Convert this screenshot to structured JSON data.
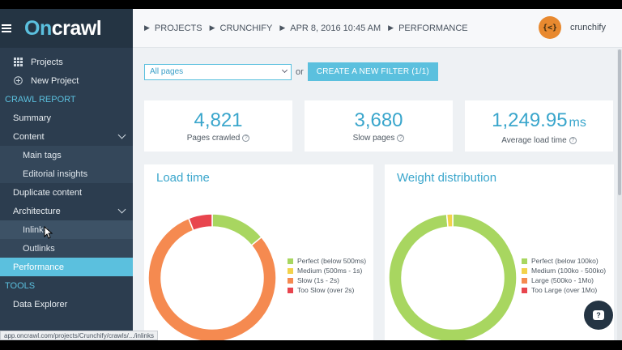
{
  "logo": {
    "part1": "On",
    "part2": "crawl"
  },
  "sidebar": {
    "items": [
      {
        "label": "Projects",
        "icon": "grid-icon"
      },
      {
        "label": "New Project",
        "icon": "plus-circle-icon"
      }
    ],
    "section_crawl": "CRAWL REPORT",
    "crawl_items": [
      {
        "label": "Summary"
      },
      {
        "label": "Content"
      },
      {
        "label": "Main tags"
      },
      {
        "label": "Editorial insights"
      },
      {
        "label": "Duplicate content"
      },
      {
        "label": "Architecture"
      },
      {
        "label": "Inlinks"
      },
      {
        "label": "Outlinks"
      },
      {
        "label": "Performance"
      }
    ],
    "section_tools": "TOOLS",
    "tools_items": [
      {
        "label": "Data Explorer"
      }
    ]
  },
  "header": {
    "breadcrumbs": [
      "PROJECTS",
      "CRUNCHIFY",
      "APR 8, 2016 10:45 AM",
      "PERFORMANCE"
    ],
    "avatar_text": "{<}",
    "username": "crunchify"
  },
  "filter": {
    "selected": "All pages",
    "or_text": "or",
    "button_label": "CREATE A NEW FILTER (1/1)"
  },
  "stats": [
    {
      "value": "4,821",
      "unit": "",
      "label": "Pages crawled"
    },
    {
      "value": "3,680",
      "unit": "",
      "label": "Slow pages"
    },
    {
      "value": "1,249.95",
      "unit": "ms",
      "label": "Average load time"
    }
  ],
  "charts": {
    "load_time": {
      "title": "Load time",
      "legend": [
        {
          "label": "Perfect (below 500ms)",
          "color": "#a8d660"
        },
        {
          "label": "Medium (500ms - 1s)",
          "color": "#f2d24b"
        },
        {
          "label": "Slow (1s - 2s)",
          "color": "#f58a50"
        },
        {
          "label": "Too Slow (over 2s)",
          "color": "#e8454e"
        }
      ]
    },
    "weight": {
      "title": "Weight distribution",
      "legend": [
        {
          "label": "Perfect (below 100ko)",
          "color": "#a8d660"
        },
        {
          "label": "Medium (100ko - 500ko)",
          "color": "#f2d24b"
        },
        {
          "label": "Large (500ko - 1Mo)",
          "color": "#f58a50"
        },
        {
          "label": "Too Large (over 1Mo)",
          "color": "#e8454e"
        }
      ]
    }
  },
  "chart_data": [
    {
      "type": "pie",
      "title": "Load time",
      "categories": [
        "Perfect (below 500ms)",
        "Medium (500ms - 1s)",
        "Slow (1s - 2s)",
        "Too Slow (over 2s)"
      ],
      "values": [
        0.14,
        0.0,
        0.8,
        0.06
      ],
      "colors": [
        "#a8d660",
        "#f2d24b",
        "#f58a50",
        "#e8454e"
      ],
      "legend": "right"
    },
    {
      "type": "pie",
      "title": "Weight distribution",
      "categories": [
        "Perfect (below 100ko)",
        "Medium (100ko - 500ko)",
        "Large (500ko - 1Mo)",
        "Too Large (over 1Mo)"
      ],
      "values": [
        0.985,
        0.015,
        0.0,
        0.0
      ],
      "colors": [
        "#a8d660",
        "#f2d24b",
        "#f58a50",
        "#e8454e"
      ],
      "legend": "right"
    }
  ],
  "status_url": "app.oncrawl.com/projects/Crunchify/crawls/.../inlinks",
  "chat_icon_text": "?"
}
